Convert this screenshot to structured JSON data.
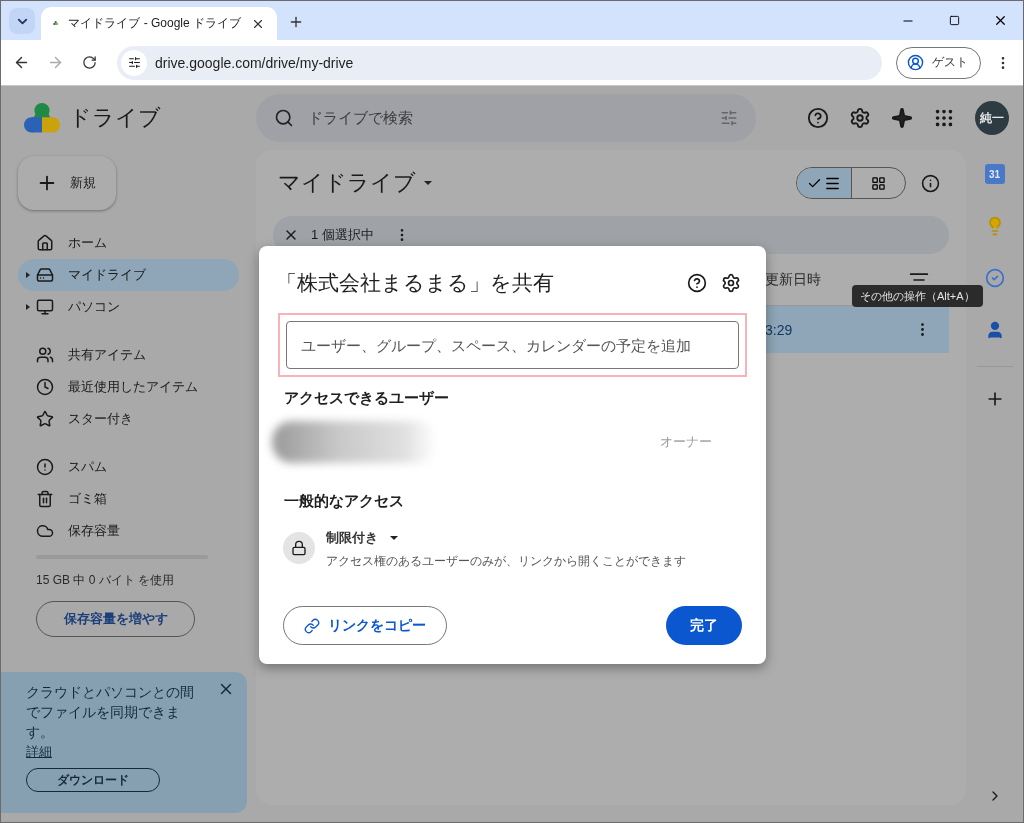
{
  "browser": {
    "tab_title": "マイドライブ - Google ドライブ",
    "url": "drive.google.com/drive/my-drive",
    "profile": "ゲスト"
  },
  "app": {
    "name": "ドライブ",
    "search_placeholder": "ドライブで検索",
    "avatar": "純一"
  },
  "sidebar": {
    "new_button": "新規",
    "groups": [
      [
        {
          "label": "ホーム",
          "selected": false,
          "expandable": false
        },
        {
          "label": "マイドライブ",
          "selected": true,
          "expandable": true
        },
        {
          "label": "パソコン",
          "selected": false,
          "expandable": true
        }
      ],
      [
        {
          "label": "共有アイテム",
          "selected": false,
          "expandable": false
        },
        {
          "label": "最近使用したアイテム",
          "selected": false,
          "expandable": false
        },
        {
          "label": "スター付き",
          "selected": false,
          "expandable": false
        }
      ],
      [
        {
          "label": "スパム",
          "selected": false,
          "expandable": false
        },
        {
          "label": "ゴミ箱",
          "selected": false,
          "expandable": false
        },
        {
          "label": "保存容量",
          "selected": false,
          "expandable": false
        }
      ]
    ],
    "storage": {
      "level": 0,
      "text": "15 GB 中 0 バイト を使用",
      "button": "保存容量を増やす"
    },
    "promo": {
      "text": "クラウドとパソコンとの間でファイルを同期できます。",
      "link": "詳細",
      "button": "ダウンロード"
    }
  },
  "main": {
    "title": "マイドライブ",
    "views": [
      {
        "selected": true
      },
      {
        "selected": false
      }
    ],
    "selection": "1 個選択中",
    "column_header": "更新日時",
    "row": {
      "modified": "3:29",
      "selected": true
    }
  },
  "tooltip": "その他の操作（Alt+A）",
  "rail": {
    "calendar_day": "31"
  },
  "dialog": {
    "title": "「株式会社まるまる」を共有",
    "input_placeholder": "ユーザー、グループ、スペース、カレンダーの予定を追加",
    "input_focused": true,
    "people_heading": "アクセスできるユーザー",
    "owner_role": "オーナー",
    "general_heading": "一般的なアクセス",
    "access_level": "制限付き",
    "access_description": "アクセス権のあるユーザーのみが、リンクから開くことができます",
    "copy_link": "リンクをコピー",
    "done": "完了"
  }
}
